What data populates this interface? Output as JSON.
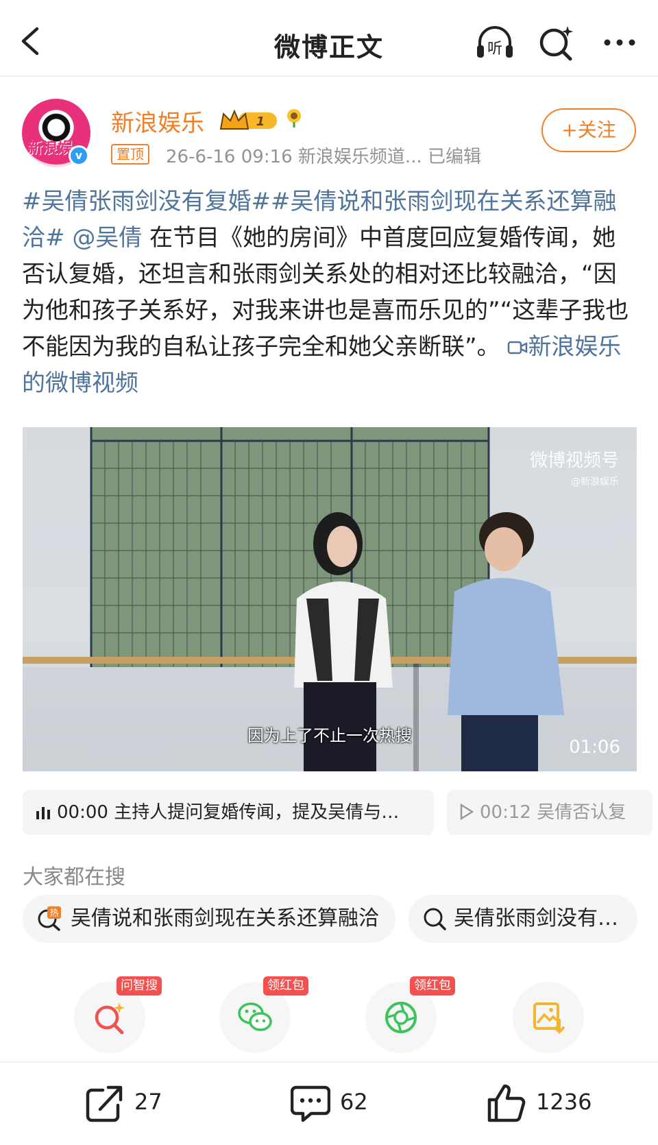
{
  "header": {
    "title": "微博正文",
    "icons": [
      "back-icon",
      "listen-icon",
      "ai-search-icon",
      "more-icon"
    ],
    "listen_label": "听"
  },
  "author": {
    "name": "新浪娱乐",
    "avatar_text": "新浪娱",
    "verified_mark": "v",
    "level": "1",
    "pinned_label": "置顶",
    "meta": "26-6-16 09:16  新浪娱乐频道...  已编辑",
    "follow_label": "+关注"
  },
  "post": {
    "tag1": "#吴倩张雨剑没有复婚#",
    "tag2": "#吴倩说和张雨剑现在关系还算融洽#",
    "mention": "@吴倩",
    "body": " 在节目《她的房间》中首度回应复婚传闻，她否认复婚，还坦言和张雨剑关系处的相对还比较融洽，“因为他和孩子关系好，对我来讲也是喜而乐见的”“这辈子我也不能因为我的自私让孩子完全和她父亲断联”。",
    "video_link": "新浪娱乐的微博视频"
  },
  "video": {
    "watermark": "微博视频号",
    "watermark_sub": "@新浪娱乐",
    "subtitle": "因为上了不止一次热搜",
    "duration": "01:06"
  },
  "chapters": [
    {
      "time": "00:00",
      "text": "主持人提问复婚传闻，提及吴倩与…"
    },
    {
      "time": "00:12",
      "text": "吴倩否认复"
    }
  ],
  "search": {
    "section_label": "大家都在搜",
    "items": [
      {
        "text": "吴倩说和张雨剑现在关系还算融洽",
        "icon": "hot-search-icon",
        "hot_label": "热"
      },
      {
        "text": "吴倩张雨剑没有…",
        "icon": "search-icon"
      }
    ]
  },
  "actions": [
    {
      "name": "ask-ai-search",
      "badge": "问智搜",
      "icon": "ai-search-icon",
      "color": "#f2514f"
    },
    {
      "name": "wechat-share",
      "badge": "领红包",
      "icon": "wechat-icon",
      "color": "#3cc45c"
    },
    {
      "name": "moments-share",
      "badge": "领红包",
      "icon": "moments-icon",
      "color": "#3cc45c"
    },
    {
      "name": "save-image",
      "badge": "",
      "icon": "save-image-icon",
      "color": "#f5b52e"
    }
  ],
  "bottom": {
    "repost": "27",
    "comment": "62",
    "like": "1236"
  }
}
